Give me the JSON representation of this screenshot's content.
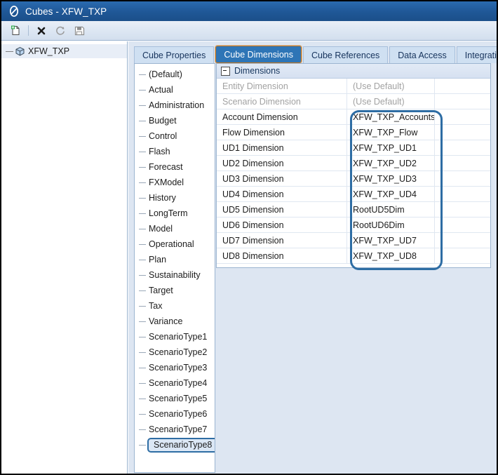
{
  "window": {
    "title": "Cubes - XFW_TXP",
    "logo_icon": "onestream-logo-icon"
  },
  "toolbar": {
    "buttons": [
      {
        "name": "new-icon",
        "label": "New"
      },
      {
        "name": "delete-icon",
        "label": "Delete"
      },
      {
        "name": "refresh-icon",
        "label": "Refresh"
      },
      {
        "name": "save-icon",
        "label": "Save"
      }
    ]
  },
  "tree": {
    "root": {
      "label": "XFW_TXP",
      "icon": "cube-icon"
    }
  },
  "tabs": [
    {
      "label": "Cube Properties",
      "active": false
    },
    {
      "label": "Cube Dimensions",
      "active": true
    },
    {
      "label": "Cube References",
      "active": false
    },
    {
      "label": "Data Access",
      "active": false
    },
    {
      "label": "Integration",
      "active": false
    }
  ],
  "scenario_list": {
    "items": [
      {
        "label": "(Default)",
        "marked": false
      },
      {
        "label": "Actual",
        "marked": false
      },
      {
        "label": "Administration",
        "marked": false
      },
      {
        "label": "Budget",
        "marked": false
      },
      {
        "label": "Control",
        "marked": false
      },
      {
        "label": "Flash",
        "marked": false
      },
      {
        "label": "Forecast",
        "marked": false
      },
      {
        "label": "FXModel",
        "marked": false
      },
      {
        "label": "History",
        "marked": false
      },
      {
        "label": "LongTerm",
        "marked": false
      },
      {
        "label": "Model",
        "marked": false
      },
      {
        "label": "Operational",
        "marked": false
      },
      {
        "label": "Plan",
        "marked": false
      },
      {
        "label": "Sustainability",
        "marked": false
      },
      {
        "label": "Target",
        "marked": false
      },
      {
        "label": "Tax",
        "marked": false
      },
      {
        "label": "Variance",
        "marked": false
      },
      {
        "label": "ScenarioType1",
        "marked": false
      },
      {
        "label": "ScenarioType2",
        "marked": false
      },
      {
        "label": "ScenarioType3",
        "marked": false
      },
      {
        "label": "ScenarioType4",
        "marked": false
      },
      {
        "label": "ScenarioType5",
        "marked": false
      },
      {
        "label": "ScenarioType6",
        "marked": false
      },
      {
        "label": "ScenarioType7",
        "marked": false
      },
      {
        "label": "ScenarioType8",
        "marked": true
      }
    ]
  },
  "grid": {
    "group_header": "Dimensions",
    "rows": [
      {
        "name": "Entity Dimension",
        "value": "(Use Default)",
        "dim": true
      },
      {
        "name": "Scenario Dimension",
        "value": "(Use Default)",
        "dim": true
      },
      {
        "name": "Account Dimension",
        "value": "XFW_TXP_Accounts",
        "dim": false
      },
      {
        "name": "Flow Dimension",
        "value": "XFW_TXP_Flow",
        "dim": false
      },
      {
        "name": "UD1 Dimension",
        "value": "XFW_TXP_UD1",
        "dim": false
      },
      {
        "name": "UD2 Dimension",
        "value": "XFW_TXP_UD2",
        "dim": false
      },
      {
        "name": "UD3 Dimension",
        "value": "XFW_TXP_UD3",
        "dim": false
      },
      {
        "name": "UD4 Dimension",
        "value": "XFW_TXP_UD4",
        "dim": false
      },
      {
        "name": "UD5 Dimension",
        "value": "RootUD5Dim",
        "dim": false
      },
      {
        "name": "UD6 Dimension",
        "value": "RootUD6Dim",
        "dim": false
      },
      {
        "name": "UD7 Dimension",
        "value": "XFW_TXP_UD7",
        "dim": false
      },
      {
        "name": "UD8 Dimension",
        "value": "XFW_TXP_UD8",
        "dim": false
      }
    ]
  },
  "annotations": {
    "value_column_highlight": "rounded rectangle around dimension value column",
    "scenario_highlight": "rounded rectangle around ScenarioType8"
  },
  "colors": {
    "titlebar": "#205493",
    "active_tab_bg": "#2e75b6",
    "active_tab_border": "#c8761a",
    "annotation": "#2e6da4",
    "pane_bg": "#dde6f2"
  }
}
